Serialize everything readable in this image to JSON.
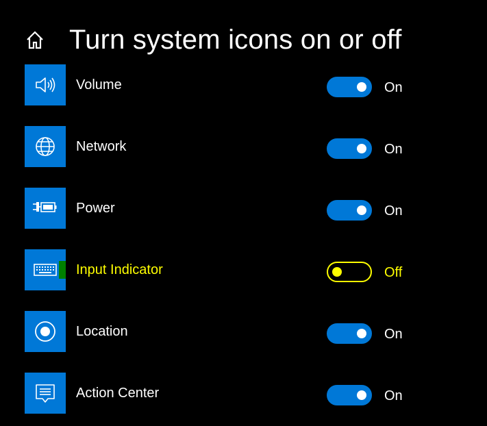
{
  "header": {
    "title": "Turn system icons on or off",
    "home_icon": "home-icon"
  },
  "colors": {
    "accent": "#0078d7",
    "focus": "#ffff00",
    "background": "#000000",
    "text": "#ffffff"
  },
  "items": [
    {
      "label": "Volume",
      "icon": "volume-icon",
      "state": "On"
    },
    {
      "label": "Network",
      "icon": "globe-icon",
      "state": "On"
    },
    {
      "label": "Power",
      "icon": "battery-plug-icon",
      "state": "On"
    },
    {
      "label": "Input Indicator",
      "icon": "keyboard-icon",
      "state": "Off"
    },
    {
      "label": "Location",
      "icon": "location-icon",
      "state": "On"
    },
    {
      "label": "Action Center",
      "icon": "action-center-icon",
      "state": "On"
    }
  ]
}
